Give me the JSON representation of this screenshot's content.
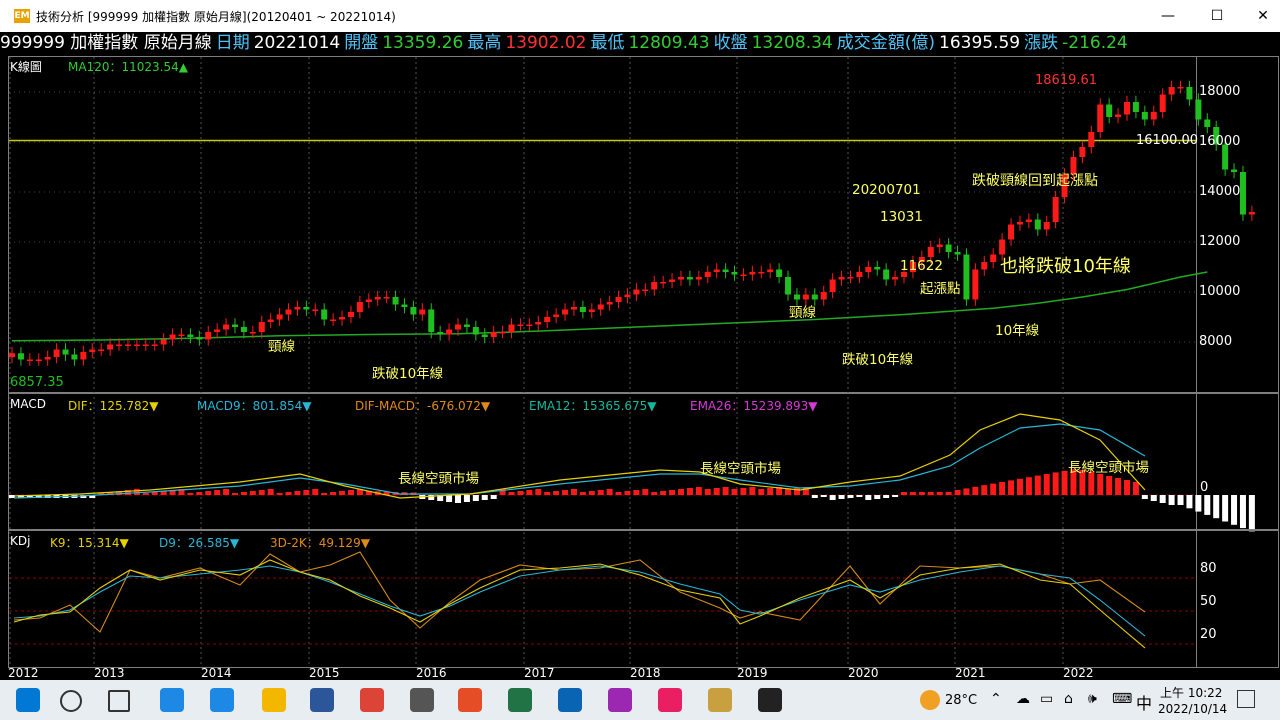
{
  "window": {
    "app_icon_text": "EM",
    "title": "技術分析 [999999 加權指數 原始月線](20120401 ~ 20221014)",
    "minimize_glyph": "—",
    "maximize_glyph": "☐",
    "close_glyph": "✕"
  },
  "infobar": [
    {
      "text": "999999 加權指數 原始月線",
      "color": "#ffffff"
    },
    {
      "text": "日期",
      "color": "#4fc3f7"
    },
    {
      "text": "20221014",
      "color": "#ffffff"
    },
    {
      "text": "開盤",
      "color": "#4fc3f7"
    },
    {
      "text": "13359.26",
      "color": "#33cc33"
    },
    {
      "text": "最高",
      "color": "#4fc3f7"
    },
    {
      "text": "13902.02",
      "color": "#ff3333"
    },
    {
      "text": "最低",
      "color": "#4fc3f7"
    },
    {
      "text": "12809.43",
      "color": "#33cc33"
    },
    {
      "text": "收盤",
      "color": "#4fc3f7"
    },
    {
      "text": "13208.34",
      "color": "#33cc33"
    },
    {
      "text": "成交金額(億)",
      "color": "#4fc3f7"
    },
    {
      "text": "16395.59",
      "color": "#ffffff"
    },
    {
      "text": "漲跌",
      "color": "#4fc3f7"
    },
    {
      "text": "-216.24",
      "color": "#33cc33"
    }
  ],
  "kline": {
    "panel_label": "K線圖",
    "ma_label": "MA120：11023.54▲",
    "high_label": "18619.61",
    "low_label": "6857.35",
    "hline_label": "16100.00",
    "y_ticks": [
      "18000",
      "16000",
      "14000",
      "12000",
      "10000",
      "8000"
    ],
    "annotations": {
      "a1": "頸線",
      "a2": "跌破10年線",
      "a3": "頸線",
      "a4": "跌破10年線",
      "a5": "20200701",
      "a6": "13031",
      "a7": "11622",
      "a8": "起漲點",
      "a9": "跌破頸線回到起漲點",
      "a10": "也將跌破10年線",
      "a11": "10年線"
    }
  },
  "macd": {
    "label": "MACD",
    "dif": "DIF：125.782▼",
    "macd9": "MACD9：801.854▼",
    "difmacd": "DIF-MACD：-676.072▼",
    "ema12": "EMA12：15365.675▼",
    "ema26": "EMA26：15239.893▼",
    "zero_label": "0",
    "annotations": {
      "b1": "長線空頭市場",
      "b2": "長線空頭市場",
      "b3": "長線空頭市場"
    }
  },
  "kd": {
    "label": "KDj",
    "k9": "K9：15.314▼",
    "d9": "D9：26.585▼",
    "d3k": "3D-2K：49.129▼",
    "y_ticks": [
      "80",
      "50",
      "20"
    ]
  },
  "x_axis": [
    "2012",
    "2013",
    "2014",
    "2015",
    "2016",
    "2017",
    "2018",
    "2019",
    "2020",
    "2021",
    "2022"
  ],
  "colors": {
    "up": "#ff1a1a",
    "down": "#1fbf1f",
    "ma": "#22aa22",
    "hline": "#c8c800",
    "dif": "#e6d000",
    "macd9": "#29b6d6",
    "kd_k": "#e6d000",
    "kd_d": "#29b6d6",
    "kd_j": "#d48a1a"
  },
  "taskbar": {
    "weather": "28°C",
    "ime": "中",
    "time": "上午 10:22",
    "date": "2022/10/14",
    "icons": [
      "windows-icon",
      "search-icon",
      "task-view-icon",
      "edge-icon",
      "ie-icon",
      "file-explorer-icon",
      "word-icon",
      "chrome-icon",
      "calculator-icon",
      "media-icon",
      "excel-icon",
      "outlook-icon",
      "paint3d-icon",
      "paint-icon",
      "stock-app-icon",
      "sticky-notes-icon"
    ]
  }
}
